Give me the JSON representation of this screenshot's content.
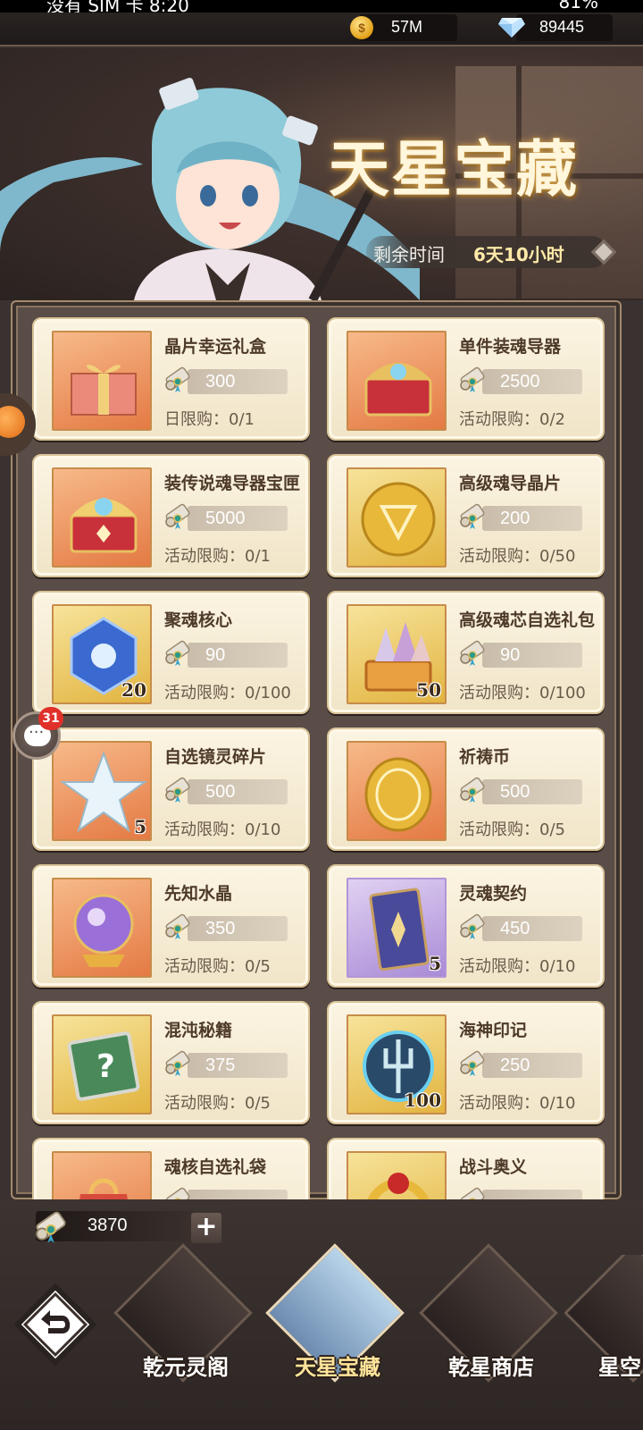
{
  "status_bar": {
    "left": "没有 SIM 卡 8:20",
    "right": "81%"
  },
  "currency": {
    "gold": {
      "icon": "gold-coin-icon",
      "value": "57M"
    },
    "diamond": {
      "icon": "diamond-icon",
      "value": "89445"
    }
  },
  "banner": {
    "title": "天星宝藏",
    "timer_label": "剩余时间",
    "timer_value": "6天10小时"
  },
  "shop": {
    "items": [
      {
        "name": "晶片幸运礼盒",
        "price": "300",
        "limit": "日限购：0/1",
        "qty": "",
        "theme": "orange",
        "icon": "gift-box-icon"
      },
      {
        "name": "单件装魂导器",
        "price": "2500",
        "limit": "活动限购：0/2",
        "qty": "",
        "theme": "orange",
        "icon": "treasure-chest-icon"
      },
      {
        "name": "装传说魂导器宝匣",
        "price": "5000",
        "limit": "活动限购：0/1",
        "qty": "",
        "theme": "orange",
        "icon": "legend-chest-icon"
      },
      {
        "name": "高级魂导晶片",
        "price": "200",
        "limit": "活动限购：0/50",
        "qty": "",
        "theme": "gold",
        "icon": "gold-chip-icon"
      },
      {
        "name": "聚魂核心",
        "price": "90",
        "limit": "活动限购：0/100",
        "qty": "20",
        "theme": "gold",
        "icon": "blue-crystal-icon"
      },
      {
        "name": "高级魂芯自选礼包",
        "price": "90",
        "limit": "活动限购：0/100",
        "qty": "50",
        "theme": "gold",
        "icon": "crystal-chest-icon"
      },
      {
        "name": "自选镜灵碎片",
        "price": "500",
        "limit": "活动限购：0/10",
        "qty": "5",
        "theme": "orange",
        "icon": "star-shard-icon"
      },
      {
        "name": "祈祷币",
        "price": "500",
        "limit": "活动限购：0/5",
        "qty": "",
        "theme": "orange",
        "icon": "prayer-coin-icon"
      },
      {
        "name": "先知水晶",
        "price": "350",
        "limit": "活动限购：0/5",
        "qty": "",
        "theme": "orange",
        "icon": "crystal-ball-icon"
      },
      {
        "name": "灵魂契约",
        "price": "450",
        "limit": "活动限购：0/10",
        "qty": "5",
        "theme": "purple",
        "icon": "contract-card-icon"
      },
      {
        "name": "混沌秘籍",
        "price": "375",
        "limit": "活动限购：0/5",
        "qty": "",
        "theme": "gold",
        "icon": "mystery-book-icon"
      },
      {
        "name": "海神印记",
        "price": "250",
        "limit": "活动限购：0/10",
        "qty": "100",
        "theme": "gold",
        "icon": "trident-emblem-icon"
      },
      {
        "name": "魂核自选礼袋",
        "price": "",
        "limit": "",
        "qty": "",
        "theme": "orange",
        "icon": "gift-bag-icon"
      },
      {
        "name": "战斗奥义",
        "price": "",
        "limit": "",
        "qty": "",
        "theme": "gold",
        "icon": "ring-icon"
      }
    ]
  },
  "chat": {
    "badge": "31"
  },
  "tickets": {
    "count": "3870",
    "plus": "+"
  },
  "nav": {
    "tabs": [
      {
        "label": "乾元灵阁"
      },
      {
        "label": "天星宝藏"
      },
      {
        "label": "乾星商店"
      },
      {
        "label": "星空"
      }
    ]
  },
  "colors": {
    "accent": "#ffe49a",
    "card_bg": "#fbf4e2",
    "price_bar": "#c9bcaa"
  }
}
